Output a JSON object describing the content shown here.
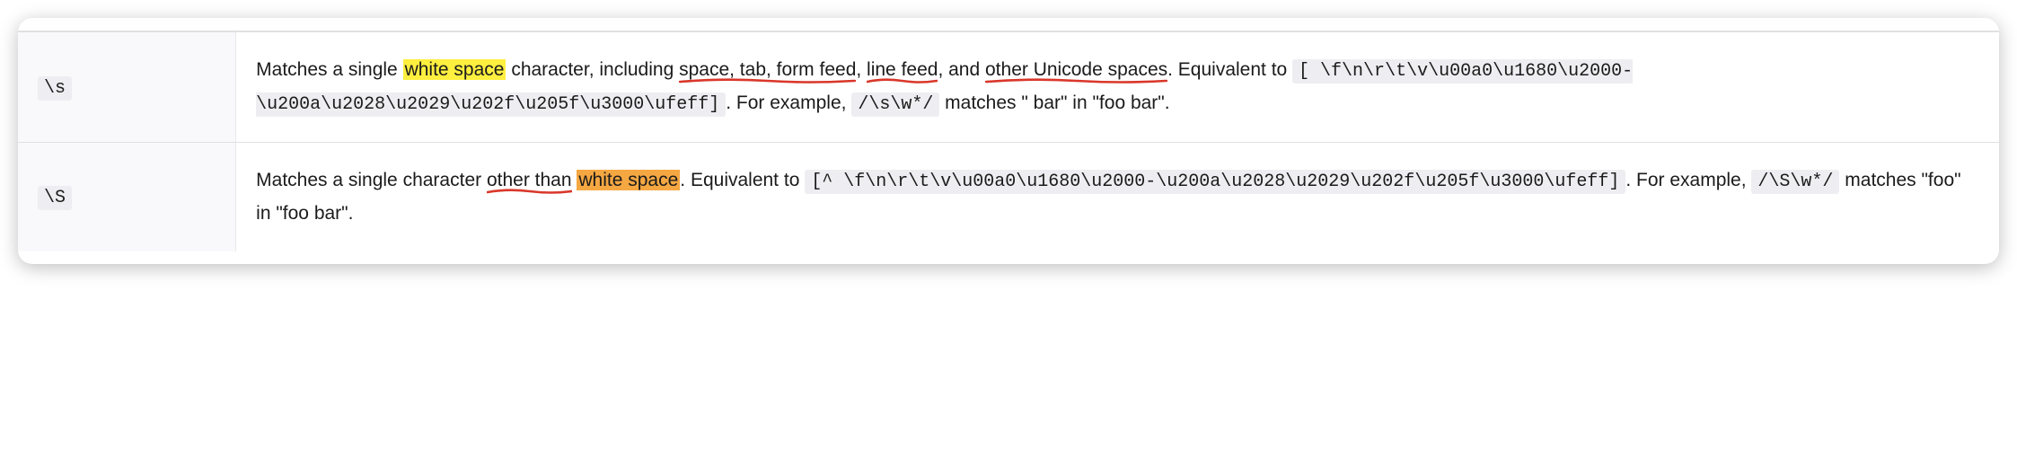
{
  "rows": [
    {
      "key": "\\s",
      "pre1": "Matches a single ",
      "hl1": "white space",
      "post1a": " character, including ",
      "ul1": "space, tab, form feed",
      "post1b": ", ",
      "ul2": "line feed",
      "post1c": ", and ",
      "ul3": "other Unicode spaces",
      "post1d": ". Equivalent to ",
      "code1": "[ \\f\\n\\r\\t\\v\\u00a0\\u1680\\u2000-\\u200a\\u2028\\u2029\\u202f\\u205f\\u3000\\ufeff]",
      "post1e": ". For example, ",
      "code2": "/\\s\\w*/",
      "post1f": " matches \" bar\" in \"foo bar\"."
    },
    {
      "key": "\\S",
      "pre2": "Matches a single character ",
      "ul4": "other than",
      "post2a": " ",
      "hl2": "white space",
      "post2b": ". Equivalent to ",
      "code3": "[^ \\f\\n\\r\\t\\v\\u00a0\\u1680\\u2000-\\u200a\\u2028\\u2029\\u202f\\u205f\\u3000\\ufeff]",
      "post2c": ". For example, ",
      "code4": "/\\S\\w*/",
      "post2d": " matches \"foo\" in \"foo bar\"."
    }
  ]
}
